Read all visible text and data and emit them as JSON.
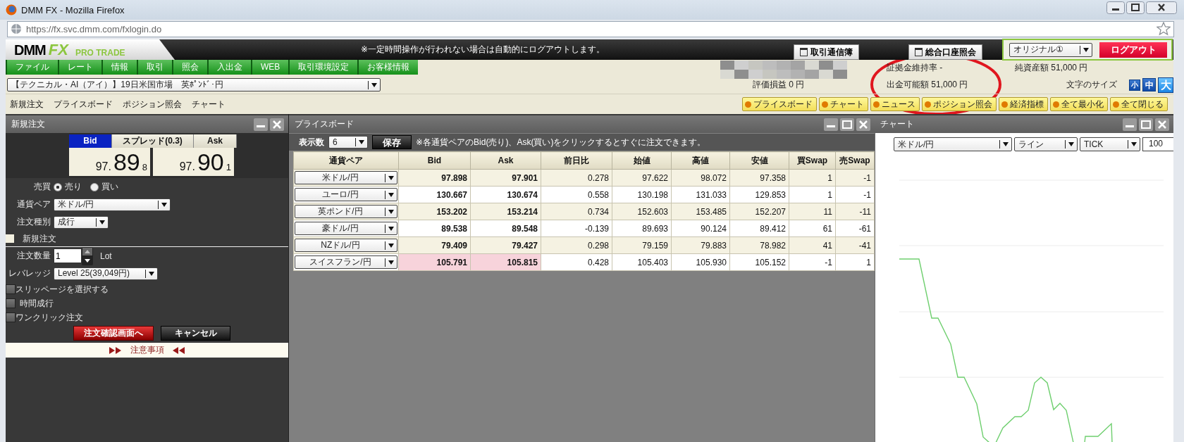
{
  "browser": {
    "title": "DMM FX - Mozilla Firefox",
    "url": "https://fx.svc.dmm.com/fxlogin.do"
  },
  "header": {
    "logo": {
      "brand": "DMM",
      "product": "FX",
      "edition": "PRO TRADE"
    },
    "notice": "※一定時間操作が行われない場合は自動的にログアウトします。",
    "buttons": [
      "取引通信簿",
      "総合口座照会"
    ],
    "layout_select": "オリジナル①",
    "logout": "ログアウト"
  },
  "menu": [
    "ファイル",
    "レート",
    "情報",
    "取引",
    "照会",
    "入出金",
    "WEB",
    "取引環境設定",
    "お客様情報"
  ],
  "account": {
    "margin_ratio": "証拠金維持率 -",
    "net_assets": "純資産額 51,000 円",
    "unrealized_pl": "評価損益 0 円",
    "withdrawable": "出金可能額 51,000 円"
  },
  "news_select": "【テクニカル・AI（アイ）】19日米国市場　英ﾎﾟﾝﾄﾞ･円",
  "font_size": {
    "label": "文字のサイズ",
    "options": [
      {
        "label": "小",
        "selected": false
      },
      {
        "label": "中",
        "selected": false
      },
      {
        "label": "大",
        "selected": true
      }
    ]
  },
  "quick_links": [
    "新規注文",
    "プライスボード",
    "ポジション照会",
    "チャート"
  ],
  "window_buttons": [
    "プライスボード",
    "チャート",
    "ニュース",
    "ポジション照会",
    "経済指標",
    "全て最小化",
    "全て閉じる"
  ],
  "order_panel": {
    "title": "新規注文",
    "quote_headers": [
      {
        "label": "Bid",
        "selected": true
      },
      {
        "label": "スプレッド(0.3)",
        "selected": false
      },
      {
        "label": "Ask",
        "selected": false
      }
    ],
    "quotes": [
      {
        "prefix": "97.",
        "main": "89",
        "suffix": "8"
      },
      {
        "prefix": "97.",
        "main": "90",
        "suffix": "1"
      }
    ],
    "side": {
      "label": "売買",
      "options": [
        {
          "label": "売り",
          "selected": true
        },
        {
          "label": "買い",
          "selected": false
        }
      ]
    },
    "pair": {
      "label": "通貨ペア",
      "value": "米ドル/円"
    },
    "order_type": {
      "label": "注文種別",
      "value": "成行"
    },
    "section": "新規注文",
    "quantity": {
      "label": "注文数量",
      "value": "1",
      "unit": "Lot"
    },
    "leverage": {
      "label": "レバレッジ",
      "value": "Level 25(39,049円)"
    },
    "options": [
      {
        "label": "スリッページを選択する",
        "checked": false
      },
      {
        "label": "時間成行",
        "checked": false
      },
      {
        "label": "ワンクリック注文",
        "checked": false
      }
    ],
    "confirm": "注文確認画面へ",
    "cancel": "キャンセル",
    "notes": "注意事項"
  },
  "price_board": {
    "title": "プライスボード",
    "count_label": "表示数",
    "count": "6",
    "save": "保存",
    "hint": "※各通貨ペアのBid(売り)、Ask(買い)をクリックするとすぐに注文できます。",
    "columns": [
      "通貨ペア",
      "Bid",
      "Ask",
      "前日比",
      "始値",
      "高値",
      "安値",
      "買Swap",
      "売Swap"
    ],
    "rows": [
      {
        "cells": [
          "米ドル/円",
          "97.898",
          "97.901",
          "0.278",
          "97.622",
          "98.072",
          "97.358",
          "1",
          "-1"
        ],
        "highlighted": false
      },
      {
        "cells": [
          "ユーロ/円",
          "130.667",
          "130.674",
          "0.558",
          "130.198",
          "131.033",
          "129.853",
          "1",
          "-1"
        ],
        "highlighted": false
      },
      {
        "cells": [
          "英ポンド/円",
          "153.202",
          "153.214",
          "0.734",
          "152.603",
          "153.485",
          "152.207",
          "11",
          "-11"
        ],
        "highlighted": false
      },
      {
        "cells": [
          "豪ドル/円",
          "89.538",
          "89.548",
          "-0.139",
          "89.693",
          "90.124",
          "89.412",
          "61",
          "-61"
        ],
        "highlighted": false
      },
      {
        "cells": [
          "NZドル/円",
          "79.409",
          "79.427",
          "0.298",
          "79.159",
          "79.883",
          "78.982",
          "41",
          "-41"
        ],
        "highlighted": false
      },
      {
        "cells": [
          "スイスフラン/円",
          "105.791",
          "105.815",
          "0.428",
          "105.403",
          "105.930",
          "105.152",
          "-1",
          "1"
        ],
        "highlighted": true
      }
    ]
  },
  "chart_panel": {
    "title": "チャート",
    "selects": [
      "米ドル/円",
      "ライン",
      "TICK"
    ],
    "count": "100"
  }
}
